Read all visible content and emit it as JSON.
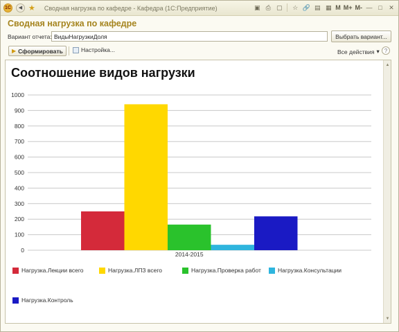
{
  "window": {
    "title": "Сводная нагрузка по кафедре - Кафедра  (1С:Предприятие)",
    "toolbar_right": {
      "m": "M",
      "m_plus": "M+",
      "m_minus": "M-"
    }
  },
  "form": {
    "title": "Сводная нагрузка по кафедре",
    "variant_label": "Вариант отчета:",
    "variant_value": "ВидыНагрузкиДоля",
    "choose_variant_label": "Выбрать вариант...",
    "generate_label": "Сформировать",
    "settings_label": "Настройка...",
    "all_actions_label": "Все действия",
    "help_label": "?"
  },
  "chart_data": {
    "type": "bar",
    "title": "Соотношение видов нагрузки",
    "categories": [
      "2014-2015"
    ],
    "ylim": [
      0,
      1000
    ],
    "yticks": [
      0,
      100,
      200,
      300,
      400,
      500,
      600,
      700,
      800,
      900,
      1000
    ],
    "grid": true,
    "legend_position": "bottom",
    "series": [
      {
        "name": "Нагрузка.Лекции всего",
        "values": [
          250
        ],
        "color": "#d42a3a"
      },
      {
        "name": "Нагрузка.ЛПЗ всего",
        "values": [
          940
        ],
        "color": "#ffd800"
      },
      {
        "name": "Нагрузка.Проверка работ",
        "values": [
          165
        ],
        "color": "#2ac22c"
      },
      {
        "name": "Нагрузка.Консультации",
        "values": [
          35
        ],
        "color": "#2eb5de"
      },
      {
        "name": "Нагрузка.Контроль",
        "values": [
          218
        ],
        "color": "#1a1ac4"
      }
    ]
  }
}
